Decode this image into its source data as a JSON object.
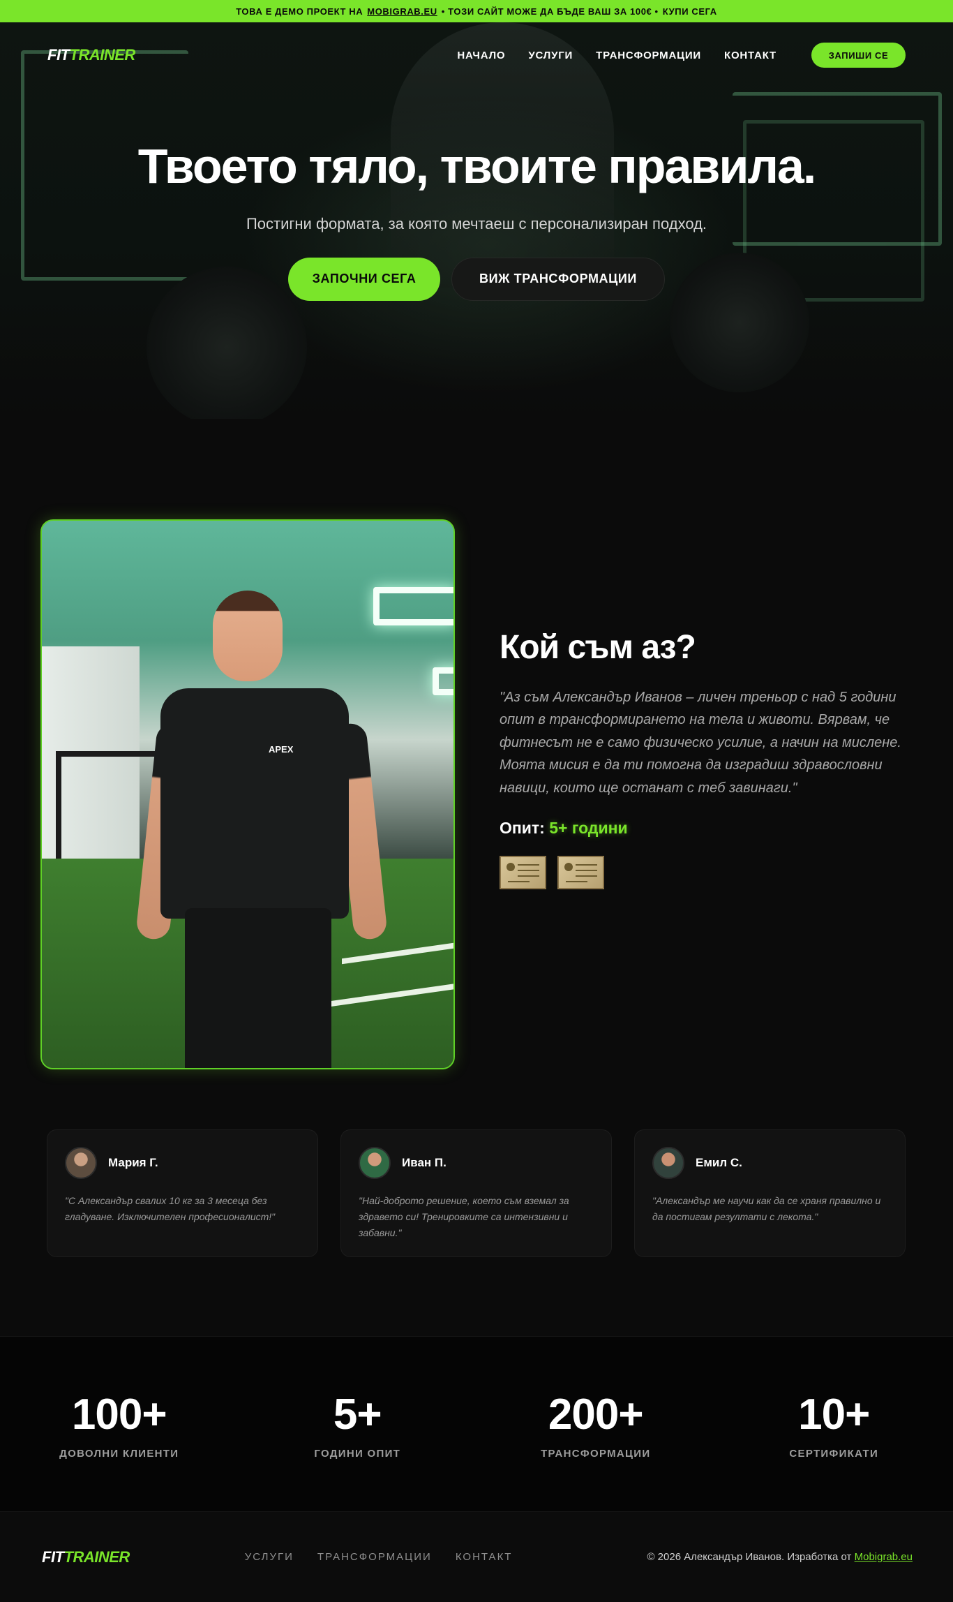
{
  "promo": {
    "prefix": "ТОВА Е ДЕМО ПРОЕКТ НА",
    "link": "MOBIGRAB.EU",
    "middle": "• ТОЗИ САЙТ МОЖЕ ДА БЪДЕ ВАШ ЗА 100€ •",
    "buy": "КУПИ СЕГА"
  },
  "brand": {
    "part1": "FIT",
    "part2": "TRAINER"
  },
  "nav": {
    "items": [
      "НАЧАЛО",
      "УСЛУГИ",
      "ТРАНСФОРМАЦИИ",
      "КОНТАКТ"
    ],
    "cta": "ЗАПИШИ СЕ"
  },
  "hero": {
    "title": "Твоето тяло, твоите правила.",
    "subtitle": "Постигни формата, за която мечтаеш с персонализиран подход.",
    "primary_cta": "ЗАПОЧНИ СЕГА",
    "secondary_cta": "ВИЖ ТРАНСФОРМАЦИИ"
  },
  "about": {
    "photo_brand": "APEX",
    "heading": "Кой съм аз?",
    "quote": "\"Аз съм Александър Иванов – личен треньор с над 5 години опит в трансформирането на тела и животи. Вярвам, че фитнесът не е само физическо усилие, а начин на мислене. Моята мисия е да ти помогна да изградиш здравословни навици, които ще останат с теб завинаги.\"",
    "exp_label": "Опит:",
    "exp_value": "5+ години"
  },
  "testimonials": [
    {
      "name": "Мария Г.",
      "text": "\"С Александър свалих 10 кг за 3 месеца без гладуване. Изключителен професионалист!\""
    },
    {
      "name": "Иван П.",
      "text": "\"Най-доброто решение, което съм вземал за здравето си! Тренировките са интензивни и забавни.\""
    },
    {
      "name": "Емил С.",
      "text": "\"Александър ме научи как да се храня правилно и да постигам резултати с лекота.\""
    }
  ],
  "stats": [
    {
      "value": "100+",
      "label": "ДОВОЛНИ КЛИЕНТИ"
    },
    {
      "value": "5+",
      "label": "ГОДИНИ ОПИТ"
    },
    {
      "value": "200+",
      "label": "ТРАНСФОРМАЦИИ"
    },
    {
      "value": "10+",
      "label": "СЕРТИФИКАТИ"
    }
  ],
  "footer": {
    "links": [
      "УСЛУГИ",
      "ТРАНСФОРМАЦИИ",
      "КОНТАКТ"
    ],
    "copy": "© 2026 Александър Иванов. Изработка от",
    "copy_link": "Mobigrab.eu"
  },
  "colors": {
    "accent": "#7ae52a",
    "background": "#0b0b0b"
  }
}
